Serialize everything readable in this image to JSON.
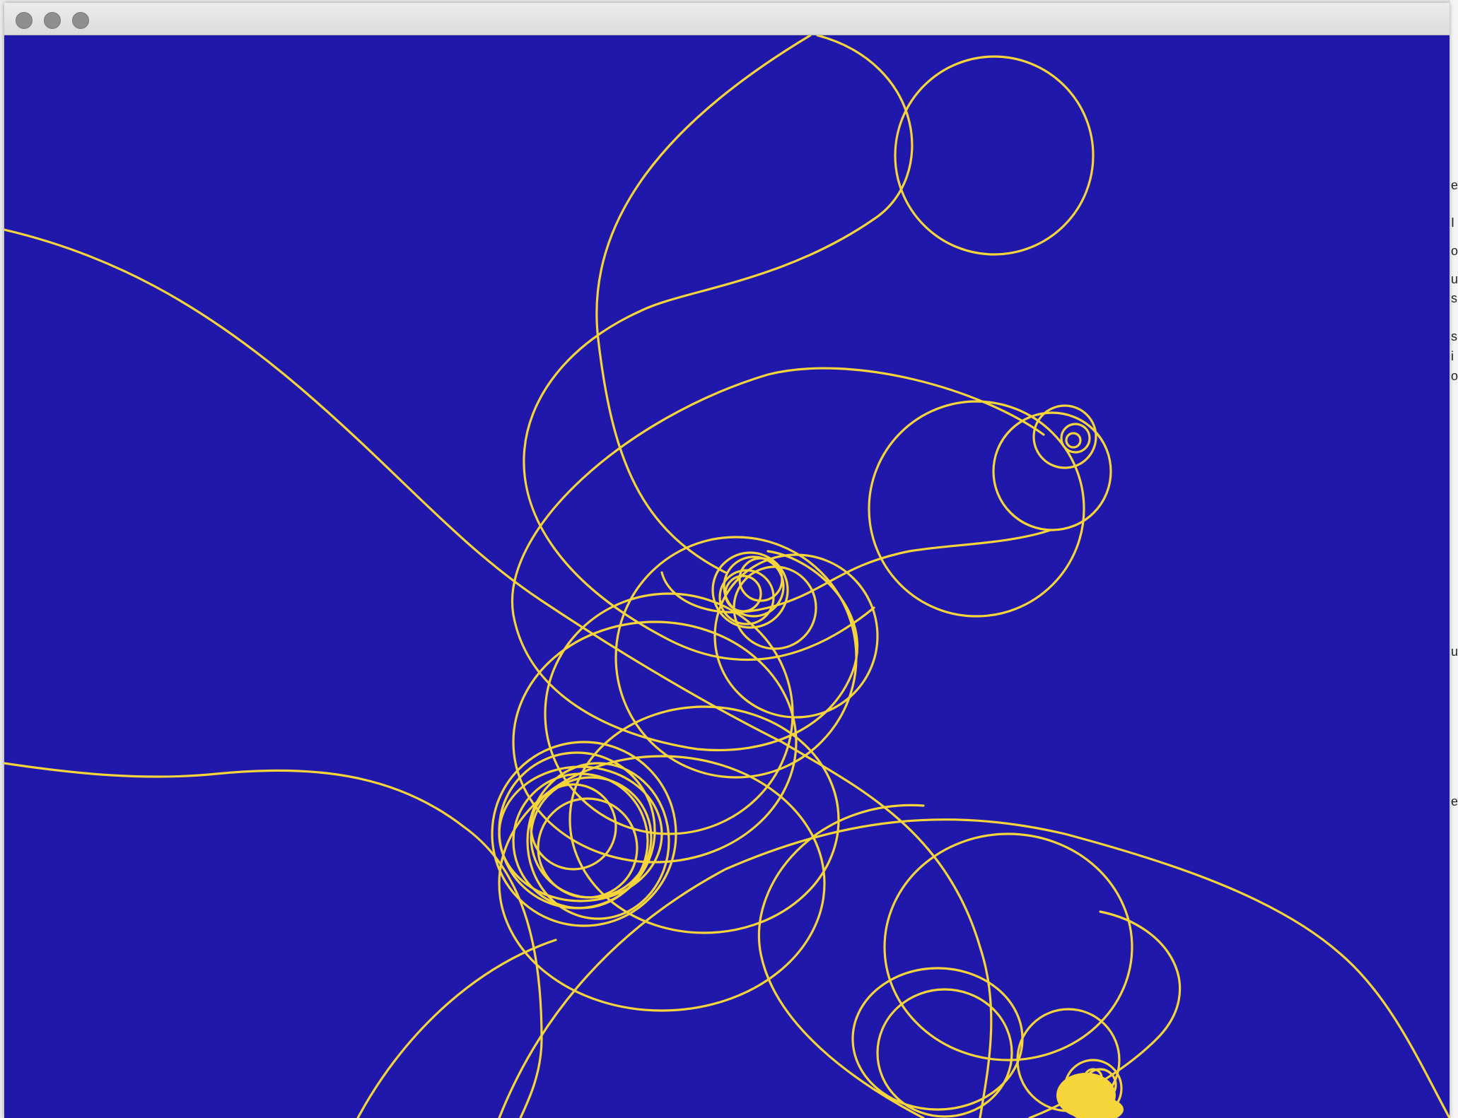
{
  "window": {
    "title": "",
    "buttons": [
      {
        "name": "close-button"
      },
      {
        "name": "minimize-button"
      },
      {
        "name": "zoom-button"
      }
    ]
  },
  "canvas": {
    "background_color": "#1f18ab",
    "stroke_color": "#f5d53a",
    "content": "spirograph-like looping curves"
  },
  "background_app": {
    "visible_fragments": [
      "e",
      "I",
      "o",
      "u",
      "s",
      "s",
      "i",
      "o",
      "u",
      "es"
    ]
  }
}
